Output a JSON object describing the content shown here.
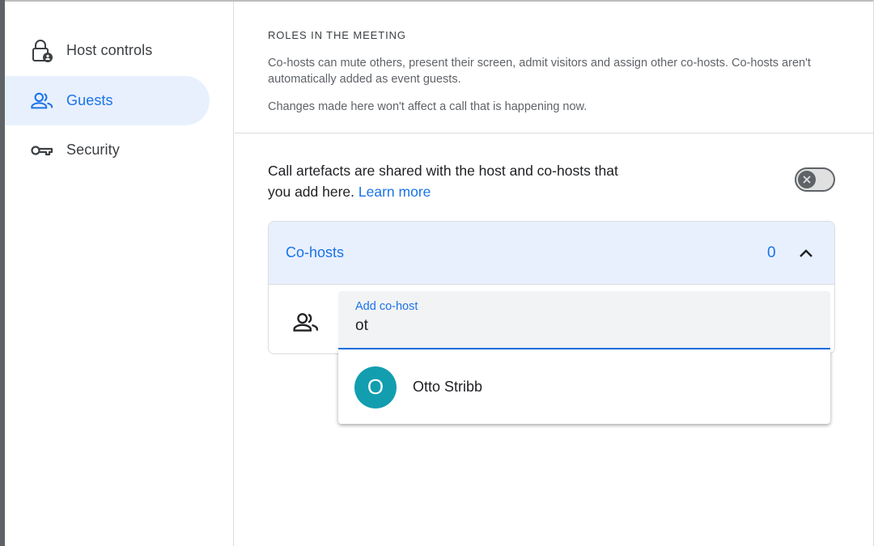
{
  "sidebar": {
    "items": [
      {
        "label": "Host controls",
        "icon": "lock-person-icon"
      },
      {
        "label": "Guests",
        "icon": "people-icon",
        "active": true
      },
      {
        "label": "Security",
        "icon": "key-icon"
      }
    ]
  },
  "roles": {
    "title": "ROLES IN THE MEETING",
    "description": "Co-hosts can mute others, present their screen, admit visitors and assign other co-hosts. Co-hosts aren't automatically added as event guests.",
    "note": "Changes made here won't affect a call that is happening now."
  },
  "artefacts": {
    "text": "Call artefacts are shared with the host and co-hosts that you add here.",
    "link": "Learn more",
    "toggle_on": false
  },
  "cohosts": {
    "label": "Co-hosts",
    "count": "0",
    "add_label": "Add co-host",
    "add_value": "ot"
  },
  "suggestions": [
    {
      "initial": "O",
      "name": "Otto Stribb",
      "avatar_color": "#129eaf"
    }
  ],
  "colors": {
    "accent": "#1a73e8",
    "active_bg": "#e8f0fe"
  }
}
